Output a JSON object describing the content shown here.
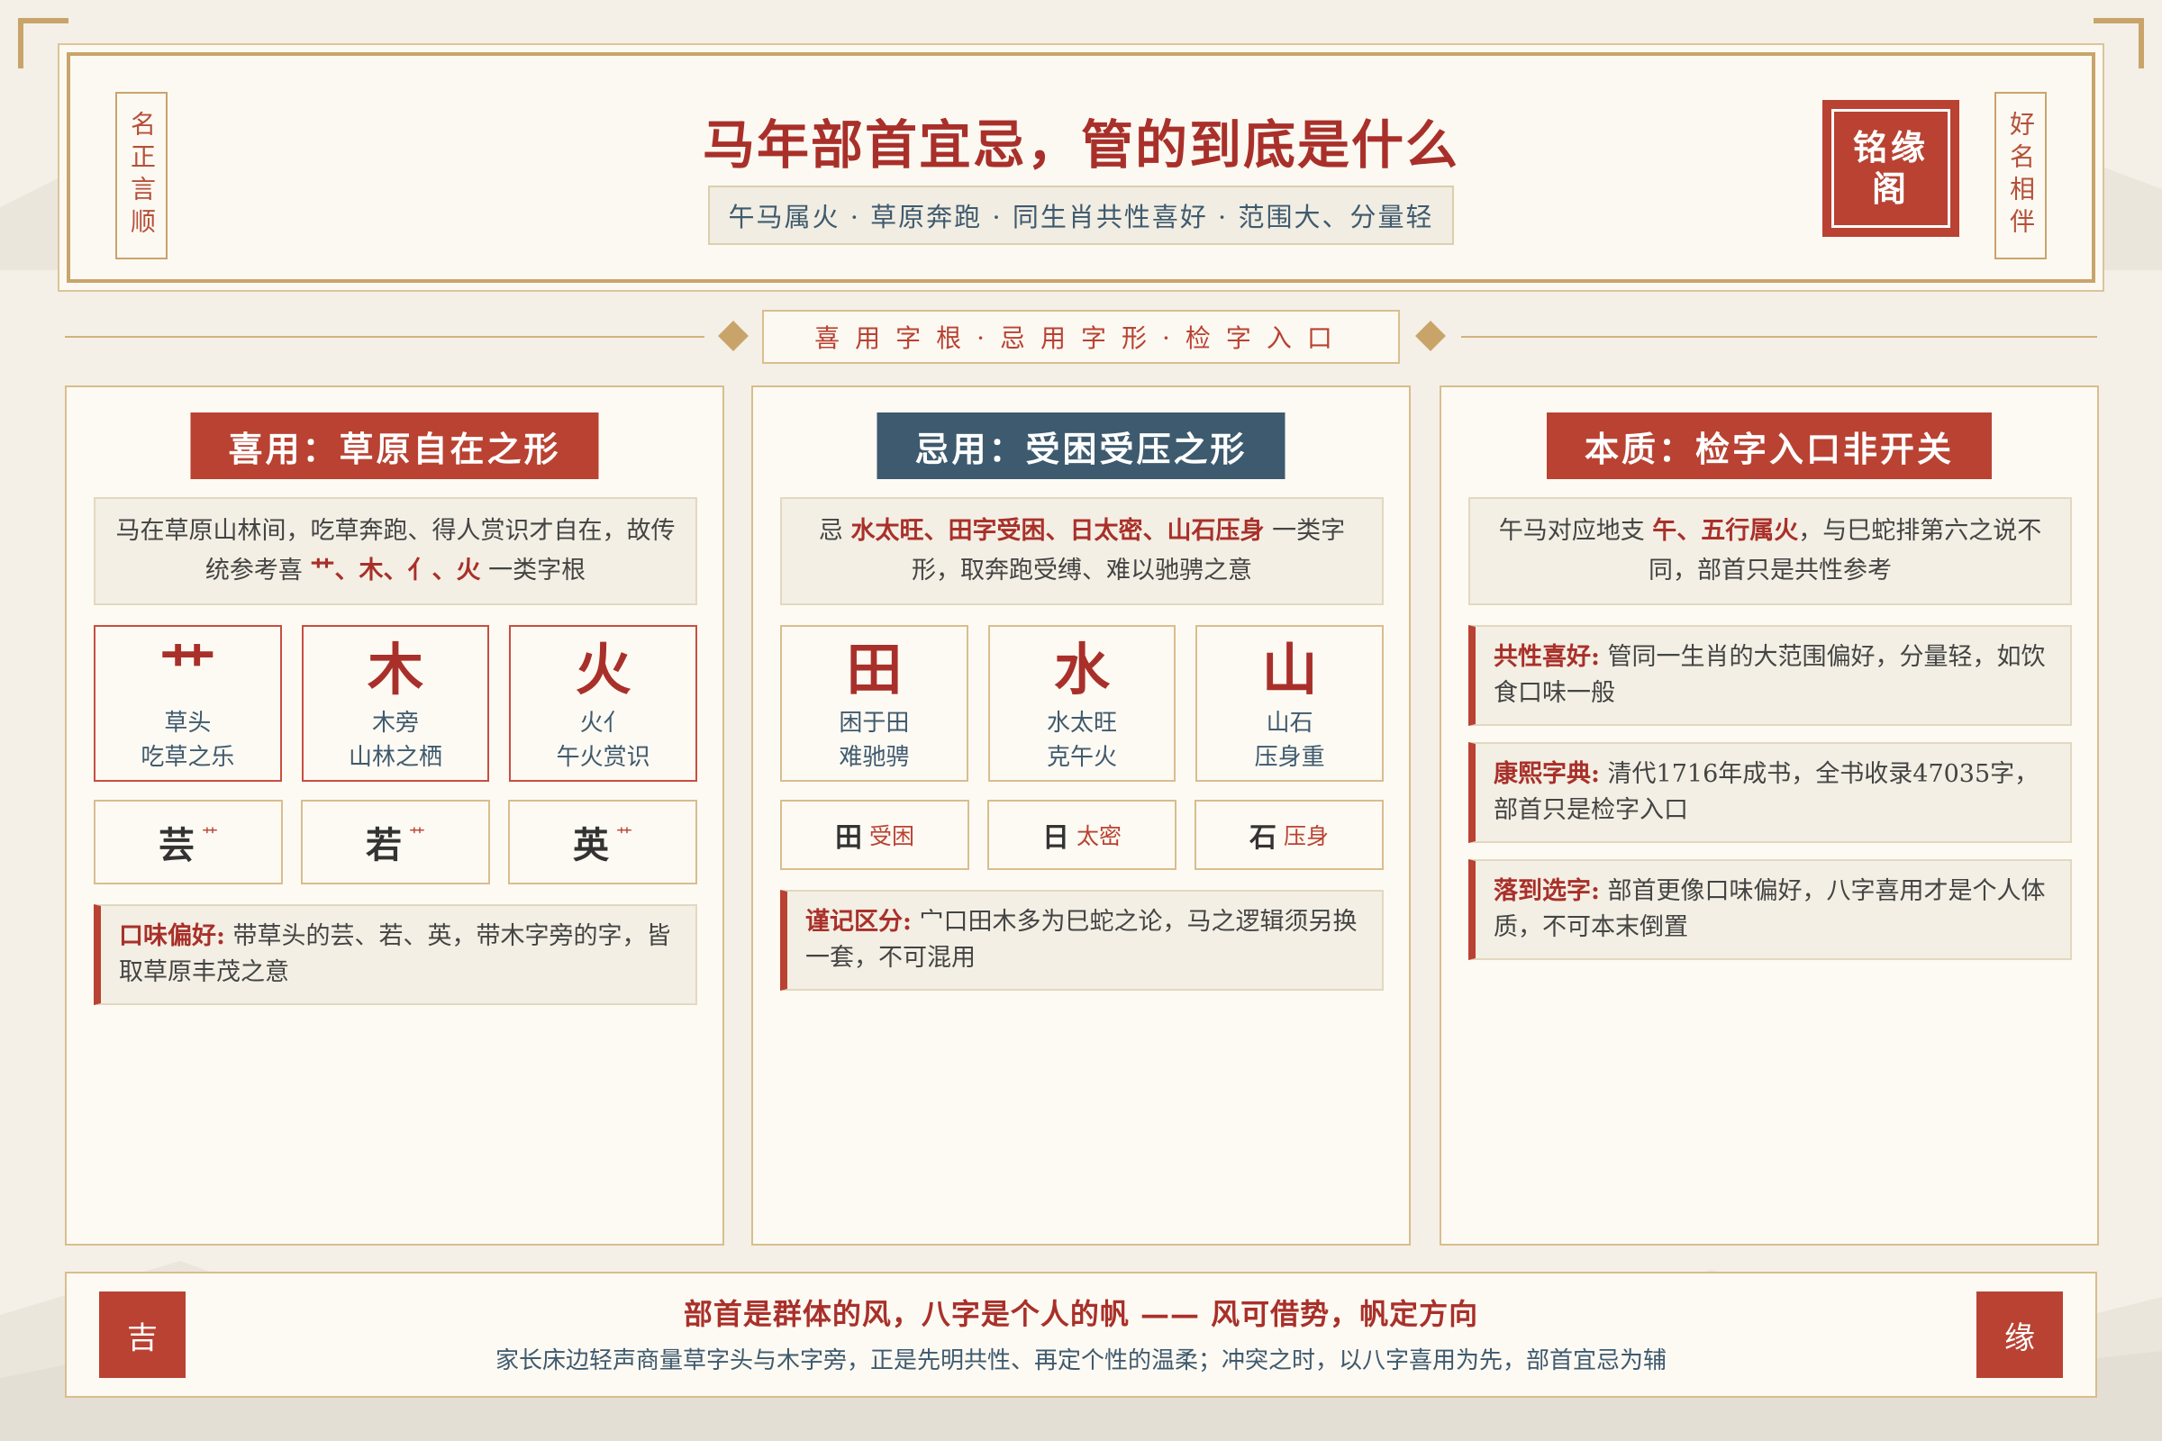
{
  "header": {
    "title": "马年部首宜忌，管的到底是什么",
    "subtitle": "午马属火 · 草原奔跑 · 同生肖共性喜好 · 范围大、分量轻",
    "left_tag": "名正言顺",
    "right_tag": "好名相伴",
    "seal": "铭缘阁"
  },
  "banner": "喜用字根·忌用字形·检字入口",
  "panels": [
    {
      "title": "喜用：草原自在之形",
      "intro_pre": "马在草原山林间，吃草奔跑、得人赏识才自在，故传统参考喜 ",
      "intro_hl": "艹、木、亻、火",
      "intro_post": " 一类字根",
      "cards": [
        {
          "char": "艹",
          "line1": "草头",
          "line2": "吃草之乐"
        },
        {
          "char": "木",
          "line1": "木旁",
          "line2": "山林之栖"
        },
        {
          "char": "火",
          "line1": "火亻",
          "line2": "午火赏识"
        }
      ],
      "examples": [
        {
          "char": "芸",
          "radical": "艹"
        },
        {
          "char": "若",
          "radical": "艹"
        },
        {
          "char": "英",
          "radical": "艹"
        }
      ],
      "note_key": "口味偏好:",
      "note_text": " 带草头的芸、若、英，带木字旁的字，皆取草原丰茂之意"
    },
    {
      "title": "忌用：受困受压之形",
      "intro_pre": "忌 ",
      "intro_hl": "水太旺、田字受困、日太密、山石压身",
      "intro_post": " 一类字形，取奔跑受缚、难以驰骋之意",
      "cards": [
        {
          "char": "田",
          "line1": "困于田",
          "line2": "难驰骋"
        },
        {
          "char": "水",
          "line1": "水太旺",
          "line2": "克午火"
        },
        {
          "char": "山",
          "line1": "山石",
          "line2": "压身重"
        }
      ],
      "examples": [
        {
          "char": "田",
          "tag": "受困"
        },
        {
          "char": "日",
          "tag": "太密"
        },
        {
          "char": "石",
          "tag": "压身"
        }
      ],
      "note_key": "谨记区分:",
      "note_text": " 宀口田木多为巳蛇之论，马之逻辑须另换一套，不可混用"
    },
    {
      "title": "本质：检字入口非开关",
      "intro_pre": "午马对应地支 ",
      "intro_hl": "午、五行属火",
      "intro_post": "，与巳蛇排第六之说不同，部首只是共性参考",
      "notes": [
        {
          "key": "共性喜好:",
          "text": " 管同一生肖的大范围偏好，分量轻，如饮食口味一般"
        },
        {
          "key": "康熙字典:",
          "text": " 清代1716年成书，全书收录47035字，部首只是检字入口"
        },
        {
          "key": "落到选字:",
          "text": " 部首更像口味偏好，八字喜用才是个人体质，不可本末倒置"
        }
      ]
    }
  ],
  "footer": {
    "title": "部首是群体的风，八字是个人的帆 —— 风可借势，帆定方向",
    "subtitle": "家长床边轻声商量草字头与木字旁，正是先明共性、再定个性的温柔；冲突之时，以八字喜用为先，部首宜忌为辅",
    "seal_left": "吉",
    "seal_right": "缘"
  },
  "colors": {
    "accent": "#b94232",
    "gold": "#c9a46a",
    "blue": "#3d5a6e",
    "bg": "#f4f0e7"
  }
}
